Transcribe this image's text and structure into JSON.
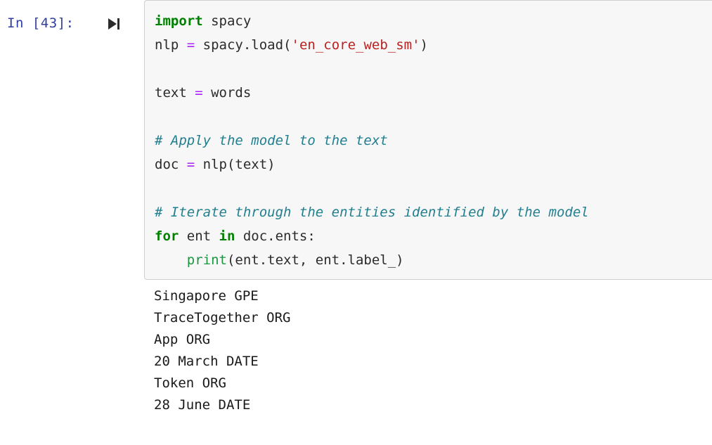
{
  "cell": {
    "prompt": "In [43]:",
    "run_icon": "run-cell-icon",
    "execution_count": 43,
    "colors": {
      "prompt": "#303f9f",
      "keyword": "#008000",
      "builtin": "#1a9641",
      "operator": "#aa22ff",
      "string": "#ba2121",
      "comment": "#227f8f",
      "plain": "#2b2b2b",
      "cell_background": "#f7f7f7",
      "cell_border": "#cfcfcf",
      "page_background": "#ffffff"
    },
    "code_lines": [
      {
        "index": 0,
        "text": "import spacy",
        "tokens": [
          {
            "t": "import",
            "k": "keyword"
          },
          {
            "t": " spacy",
            "k": "plain"
          }
        ]
      },
      {
        "index": 1,
        "text": "nlp = spacy.load('en_core_web_sm')",
        "tokens": [
          {
            "t": "nlp ",
            "k": "plain"
          },
          {
            "t": "=",
            "k": "operator"
          },
          {
            "t": " spacy.load(",
            "k": "plain"
          },
          {
            "t": "'en_core_web_sm'",
            "k": "string"
          },
          {
            "t": ")",
            "k": "plain"
          }
        ]
      },
      {
        "index": 2,
        "text": "",
        "tokens": []
      },
      {
        "index": 3,
        "text": "text = words",
        "tokens": [
          {
            "t": "text ",
            "k": "plain"
          },
          {
            "t": "=",
            "k": "operator"
          },
          {
            "t": " words",
            "k": "plain"
          }
        ]
      },
      {
        "index": 4,
        "text": "",
        "tokens": []
      },
      {
        "index": 5,
        "text": "# Apply the model to the text",
        "tokens": [
          {
            "t": "# Apply the model to the text",
            "k": "comment"
          }
        ]
      },
      {
        "index": 6,
        "text": "doc = nlp(text)",
        "tokens": [
          {
            "t": "doc ",
            "k": "plain"
          },
          {
            "t": "=",
            "k": "operator"
          },
          {
            "t": " nlp(text)",
            "k": "plain"
          }
        ]
      },
      {
        "index": 7,
        "text": "",
        "tokens": []
      },
      {
        "index": 8,
        "text": "# Iterate through the entities identified by the model",
        "tokens": [
          {
            "t": "# Iterate through the entities identified by the model",
            "k": "comment"
          }
        ]
      },
      {
        "index": 9,
        "text": "for ent in doc.ents:",
        "tokens": [
          {
            "t": "for",
            "k": "keyword"
          },
          {
            "t": " ent ",
            "k": "plain"
          },
          {
            "t": "in",
            "k": "keyword"
          },
          {
            "t": " doc.ents:",
            "k": "plain"
          }
        ]
      },
      {
        "index": 10,
        "text": "    print(ent.text, ent.label_)",
        "tokens": [
          {
            "t": "    ",
            "k": "plain"
          },
          {
            "t": "print",
            "k": "builtin"
          },
          {
            "t": "(ent.text, ent.label_)",
            "k": "plain"
          }
        ]
      }
    ],
    "output_lines": [
      "Singapore GPE",
      "TraceTogether ORG",
      "App ORG",
      "20 March DATE",
      "Token ORG",
      "28 June DATE"
    ]
  }
}
